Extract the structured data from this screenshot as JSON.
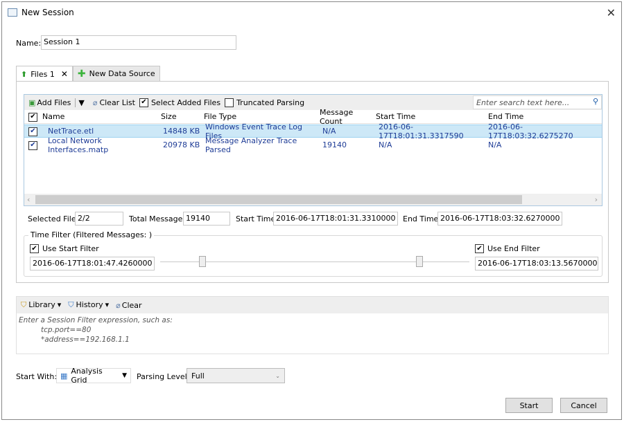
{
  "window": {
    "title": "New Session",
    "icon": "session-icon",
    "close_icon": "close-icon"
  },
  "name": {
    "label": "Name:",
    "value": "Session 1"
  },
  "tabs": [
    {
      "label": "Files 1",
      "icon": "file-arrow-icon",
      "close": "close-icon",
      "active": true
    },
    {
      "label": "New Data Source",
      "icon": "green-plus-icon",
      "active": false
    }
  ],
  "toolbar": {
    "add_files": "Add Files",
    "clear_list": "Clear List",
    "select_added_files": {
      "label": "Select Added Files",
      "checked": true
    },
    "truncated_parsing": {
      "label": "Truncated Parsing",
      "checked": false
    },
    "search_placeholder": "Enter search text here..."
  },
  "grid": {
    "columns": [
      "Name",
      "Size",
      "File Type",
      "Message Count",
      "Start Time",
      "End Time"
    ],
    "rows": [
      {
        "checked": true,
        "selected": true,
        "name": "NetTrace.etl",
        "size": "14848 KB",
        "file_type": "Windows Event Trace Log Files",
        "message_count": "N/A",
        "start_time": "2016-06-17T18:01:31.3317590",
        "end_time": "2016-06-17T18:03:32.6275270"
      },
      {
        "checked": true,
        "selected": false,
        "name": "Local Network Interfaces.matp",
        "size": "20978 KB",
        "file_type": "Message Analyzer Trace Parsed",
        "message_count": "19140",
        "start_time": "N/A",
        "end_time": "N/A"
      }
    ]
  },
  "summary": {
    "selected_files_label": "Selected Files:",
    "selected_files": "2/2",
    "total_messages_label": "Total Messages:",
    "total_messages": "19140",
    "start_time_label": "Start Time:",
    "start_time": "2016-06-17T18:01:31.3310000",
    "end_time_label": "End Time:",
    "end_time": "2016-06-17T18:03:32.6270000"
  },
  "time_filter": {
    "title": "Time Filter (Filtered Messages: )",
    "use_start": {
      "label": "Use Start Filter",
      "checked": true,
      "value": "2016-06-17T18:01:47.4260000"
    },
    "use_end": {
      "label": "Use End Filter",
      "checked": true,
      "value": "2016-06-17T18:03:13.5670000"
    }
  },
  "filter": {
    "library": "Library",
    "history": "History",
    "clear": "Clear",
    "hint_line1": "Enter a Session Filter expression, such as:",
    "hint_line2": "tcp.port==80",
    "hint_line3": "*address==192.168.1.1"
  },
  "footer": {
    "start_with_label": "Start With:",
    "start_with_value": "Analysis Grid",
    "parsing_level_label": "Parsing Level:",
    "parsing_level_value": "Full",
    "start_button": "Start",
    "cancel_button": "Cancel"
  }
}
